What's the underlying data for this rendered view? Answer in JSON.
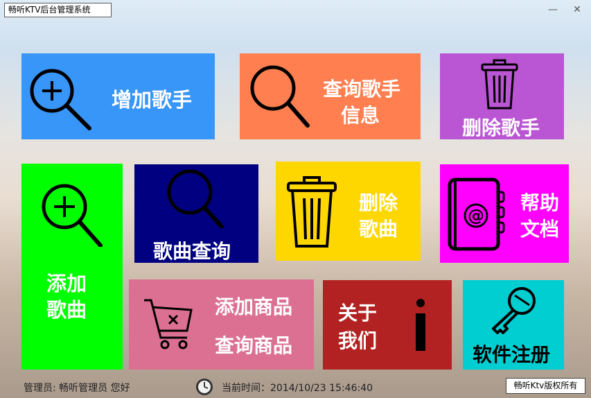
{
  "window": {
    "title": "畅听KTV后台管理系统",
    "minimize_glyph": "—",
    "close_glyph": "✕"
  },
  "tiles": {
    "add_singer": {
      "label": "增加歌手",
      "color": "#3896f8",
      "icon": "zoom-in-icon"
    },
    "query_singer": {
      "label_line1": "查询歌手",
      "label_line2": "信息",
      "color": "#ff7f50",
      "icon": "search-icon"
    },
    "delete_singer": {
      "label": "删除歌手",
      "color": "#ba55d3",
      "icon": "trash-icon"
    },
    "add_song": {
      "label_line1": "添加",
      "label_line2": "歌曲",
      "color": "#00ff00",
      "icon": "zoom-in-icon"
    },
    "song_query": {
      "label": "歌曲查询",
      "color": "#000080",
      "icon": "search-icon"
    },
    "delete_song": {
      "label_line1": "删除",
      "label_line2": "歌曲",
      "color": "#ffd700",
      "icon": "trash-icon"
    },
    "help_doc": {
      "label_line1": "帮助",
      "label_line2": "文档",
      "color": "#ff00ff",
      "icon": "address-book-icon"
    },
    "goods": {
      "add_label": "添加商品",
      "query_label": "查询商品",
      "color": "#db7093",
      "icon": "cart-icon"
    },
    "about_us": {
      "label_line1": "关于",
      "label_line2": "我们",
      "color": "#b22222",
      "icon": "info-icon"
    },
    "register": {
      "label": "软件注册",
      "color": "#00ced1",
      "icon": "key-icon"
    }
  },
  "footer": {
    "admin_text": "管理员: 畅听管理员 您好",
    "time_text": "当前时间：2014/10/23 15:46:40",
    "copyright": "畅听Ktv版权所有",
    "clock_icon": "clock-icon"
  }
}
